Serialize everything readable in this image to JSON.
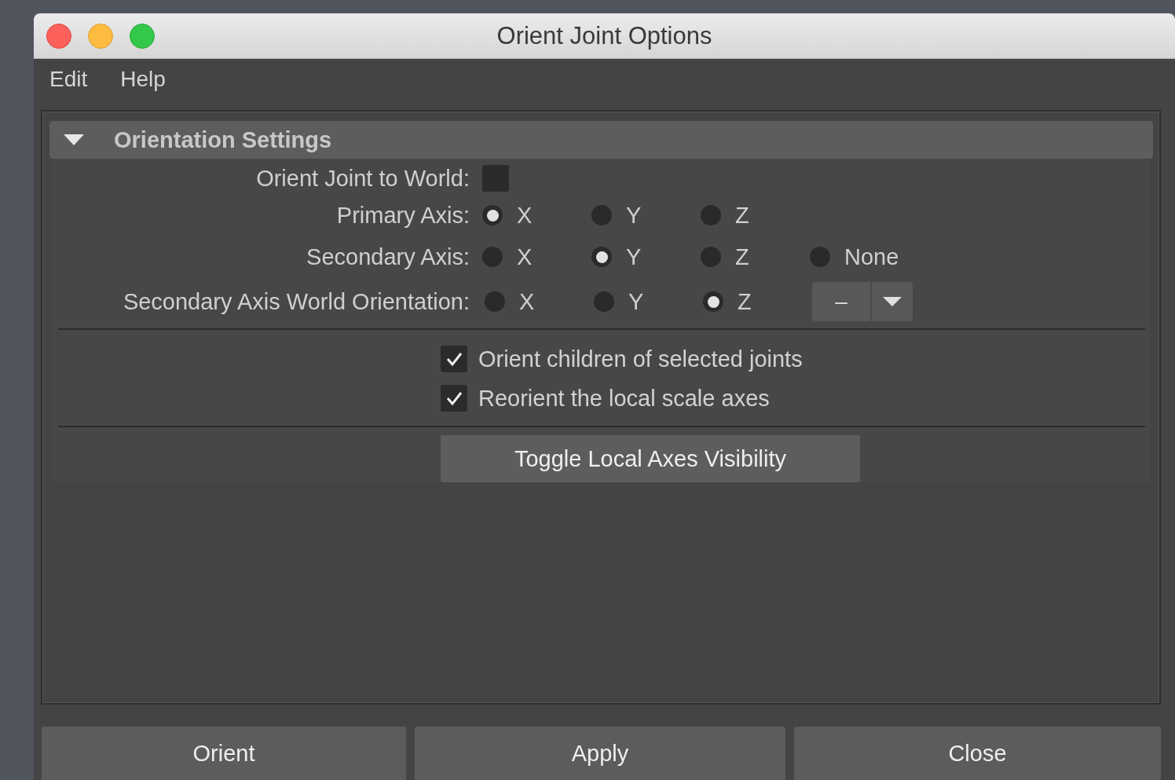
{
  "window": {
    "title": "Orient Joint Options"
  },
  "menu": [
    {
      "label": "Edit"
    },
    {
      "label": "Help"
    }
  ],
  "section": {
    "title": "Orientation Settings",
    "expanded": true,
    "orient_to_world": {
      "label": "Orient Joint to World:",
      "checked": false
    },
    "radio_groups": [
      {
        "label": "Primary Axis:",
        "options": [
          {
            "label": "X",
            "selected": true
          },
          {
            "label": "Y",
            "selected": false
          },
          {
            "label": "Z",
            "selected": false
          }
        ]
      },
      {
        "label": "Secondary Axis:",
        "options": [
          {
            "label": "X",
            "selected": false
          },
          {
            "label": "Y",
            "selected": true
          },
          {
            "label": "Z",
            "selected": false
          },
          {
            "label": "None",
            "selected": false
          }
        ]
      },
      {
        "label": "Secondary Axis World Orientation:",
        "options": [
          {
            "label": "X",
            "selected": false
          },
          {
            "label": "Y",
            "selected": false
          },
          {
            "label": "Z",
            "selected": true
          }
        ],
        "dropdown": {
          "value": "–"
        }
      }
    ],
    "checkboxes": [
      {
        "label": "Orient children of selected joints",
        "checked": true
      },
      {
        "label": "Reorient the local scale axes",
        "checked": true
      }
    ],
    "button": "Toggle Local Axes Visibility"
  },
  "buttons": [
    "Orient",
    "Apply",
    "Close"
  ]
}
